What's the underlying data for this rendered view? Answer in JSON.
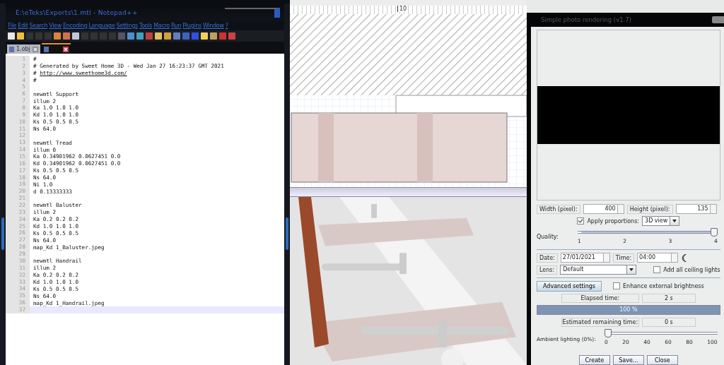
{
  "notepad": {
    "title": "E:\\eTeks\\Exports\\1.mtl - Notepad++",
    "menu": [
      "File",
      "Edit",
      "Search",
      "View",
      "Encoding",
      "Language",
      "Settings",
      "Tools",
      "Macro",
      "Run",
      "Plugins",
      "Window",
      "?"
    ],
    "tabs": [
      {
        "label": "1.obj",
        "selected": false
      },
      {
        "selected": true
      }
    ],
    "lines": [
      {
        "n": "1",
        "text": "#",
        "current": false
      },
      {
        "n": "2",
        "text": "# Generated by Sweet Home 3D - Wed Jan 27 16:23:37 GMT 2021",
        "current": false
      },
      {
        "n": "3",
        "text": "# ",
        "url": "http://www.sweethome3d.com/",
        "current": false
      },
      {
        "n": "4",
        "text": "#",
        "current": false
      },
      {
        "n": "5",
        "current": false
      },
      {
        "n": "6",
        "text": "newmtl Support",
        "current": false
      },
      {
        "n": "7",
        "text": "illum 2",
        "current": false
      },
      {
        "n": "8",
        "text": "Ka 1.0 1.0 1.0",
        "current": false
      },
      {
        "n": "9",
        "text": "Kd 1.0 1.0 1.0",
        "current": false
      },
      {
        "n": "10",
        "text": "Ks 0.5 0.5 0.5",
        "current": false
      },
      {
        "n": "11",
        "text": "Ns 64.0",
        "current": false
      },
      {
        "n": "12",
        "current": false
      },
      {
        "n": "13",
        "text": "newmtl Tread",
        "current": false
      },
      {
        "n": "14",
        "text": "illum 0",
        "current": false
      },
      {
        "n": "15",
        "text": "Ka 0.34901962 0.0627451 0.0",
        "current": false
      },
      {
        "n": "16",
        "text": "Kd 0.34901962 0.0627451 0.0",
        "current": false
      },
      {
        "n": "17",
        "text": "Ks 0.5 0.5 0.5",
        "current": false
      },
      {
        "n": "18",
        "text": "Ns 64.0",
        "current": false
      },
      {
        "n": "19",
        "text": "Ni 1.0",
        "current": false
      },
      {
        "n": "20",
        "text": "d 0.13333333",
        "current": false
      },
      {
        "n": "21",
        "current": false
      },
      {
        "n": "22",
        "text": "newmtl Baluster",
        "current": false
      },
      {
        "n": "23",
        "text": "illum 2",
        "current": false
      },
      {
        "n": "24",
        "text": "Ka 0.2 0.2 0.2",
        "current": false
      },
      {
        "n": "25",
        "text": "Kd 1.0 1.0 1.0",
        "current": false
      },
      {
        "n": "26",
        "text": "Ks 0.5 0.5 0.5",
        "current": false
      },
      {
        "n": "27",
        "text": "Ns 64.0",
        "current": false
      },
      {
        "n": "28",
        "text": "map_Kd 1_Baluster.jpeg",
        "current": false
      },
      {
        "n": "29",
        "current": false
      },
      {
        "n": "30",
        "text": "newmtl Handrail",
        "current": false
      },
      {
        "n": "31",
        "text": "illum 2",
        "current": false
      },
      {
        "n": "32",
        "text": "Ka 0.2 0.2 0.2",
        "current": false
      },
      {
        "n": "33",
        "text": "Kd 1.0 1.0 1.0",
        "current": false
      },
      {
        "n": "34",
        "text": "Ks 0.5 0.5 0.5",
        "current": false
      },
      {
        "n": "35",
        "text": "Ns 64.0",
        "current": false
      },
      {
        "n": "36",
        "text": "map_Kd 1_Handrail.jpeg",
        "current": false
      },
      {
        "n": "37",
        "current": true
      }
    ]
  },
  "plan": {
    "ruler_label": "10"
  },
  "dialog": {
    "title": "Simple photo rendering (v1.7)",
    "width": {
      "label": "Width (pixel):",
      "value": "400"
    },
    "height": {
      "label": "Height (pixel):",
      "value": "135"
    },
    "apply_proportions": {
      "label": "Apply proportions:",
      "checked": true
    },
    "proportions": {
      "value": "3D view"
    },
    "quality": {
      "label": "Quality:",
      "ticks": [
        "1",
        "2",
        "3",
        "4"
      ],
      "level": 1
    },
    "date": {
      "label": "Date:",
      "value": "27/01/2021"
    },
    "time": {
      "label": "Time:",
      "value": "04:00"
    },
    "lens": {
      "label": "Lens:",
      "value": "Default"
    },
    "ceiling_lights": {
      "label": "Add all ceiling lights",
      "checked": false
    },
    "advanced_button": "Advanced settings",
    "enhance": {
      "label": "Enhance external brightness",
      "checked": false
    },
    "elapsed": {
      "label": "Elapsed time:",
      "value": "2 s"
    },
    "progress": {
      "label": "100 %",
      "level": 1
    },
    "remaining": {
      "label": "Estimated remaining time:",
      "value": "0 s"
    },
    "ambient": {
      "label": "Ambient lighting (0%):",
      "ticks": [
        "0",
        "20",
        "40",
        "60",
        "80",
        "100"
      ],
      "level": 0
    },
    "buttons": [
      "Create",
      "Save...",
      "Close"
    ]
  }
}
